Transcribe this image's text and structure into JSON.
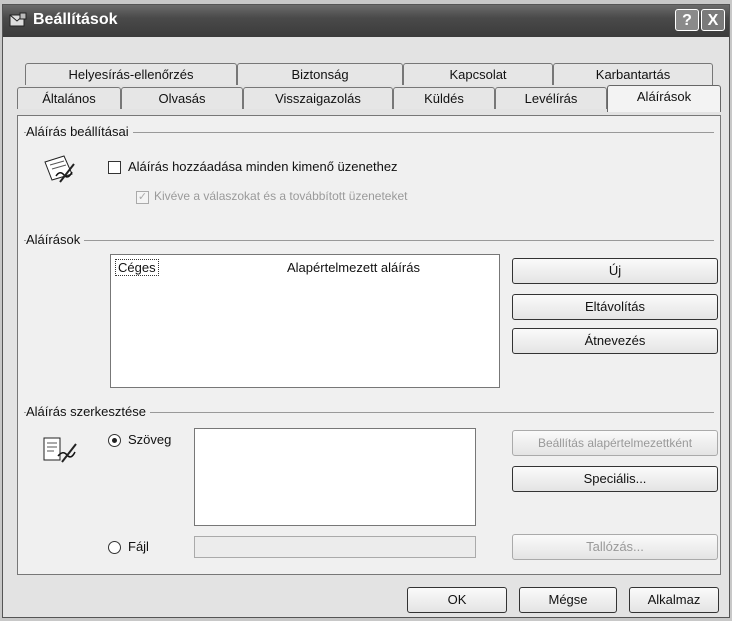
{
  "window": {
    "title": "Beállítások",
    "help_button": "?",
    "close_button": "X"
  },
  "tabs_row1": [
    {
      "label": "Helyesírás-ellenőrzés"
    },
    {
      "label": "Biztonság"
    },
    {
      "label": "Kapcsolat"
    },
    {
      "label": "Karbantartás"
    }
  ],
  "tabs_row2": [
    {
      "label": "Általános"
    },
    {
      "label": "Olvasás"
    },
    {
      "label": "Visszaigazolás"
    },
    {
      "label": "Küldés"
    },
    {
      "label": "Levélírás"
    },
    {
      "label": "Aláírások",
      "active": true
    }
  ],
  "settings_group": {
    "title": "Aláírás beállításai",
    "add_signature_label": "Aláírás hozzáadása minden kimenő üzenethez",
    "add_signature_checked": false,
    "except_replies_label": "Kivéve a válaszokat és a továbbított üzeneteket",
    "except_replies_checked": true
  },
  "signatures_group": {
    "title": "Aláírások",
    "items": [
      {
        "name": "Céges",
        "note": "Alapértelmezett aláírás"
      }
    ],
    "new_button": "Új",
    "remove_button": "Eltávolítás",
    "rename_button": "Átnevezés"
  },
  "edit_group": {
    "title": "Aláírás szerkesztése",
    "text_option": "Szöveg",
    "text_selected": true,
    "file_option": "Fájl",
    "set_default_button": "Beállítás alapértelmezettként",
    "advanced_button": "Speciális...",
    "browse_button": "Tallózás..."
  },
  "footer": {
    "ok": "OK",
    "cancel": "Mégse",
    "apply": "Alkalmaz"
  }
}
